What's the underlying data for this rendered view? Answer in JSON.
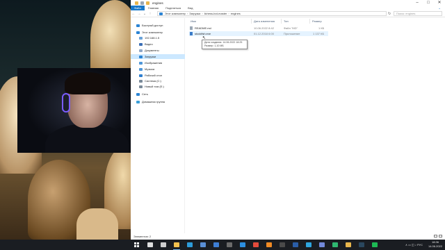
{
  "window": {
    "title": "engines",
    "controls": {
      "minimize": "–",
      "maximize": "□",
      "close": "✕"
    }
  },
  "ribbon": {
    "tabs": [
      "Файл",
      "Главная",
      "Поделиться",
      "Вид"
    ],
    "expand_glyph": "⌄"
  },
  "address": {
    "crumbs": [
      "Этот компьютер",
      "Загрузки",
      "lichess-bot-master",
      "engines"
    ],
    "search_placeholder": "Поиск: engines"
  },
  "navpane": {
    "items": [
      {
        "label": "Быстрый доступ",
        "icon": "star-icon",
        "color": "#2b84d4"
      },
      {
        "label": "Этот компьютер",
        "icon": "computer-icon",
        "color": "#2b84d4"
      },
      {
        "label": "192.168.1.5",
        "icon": "network-drive-icon",
        "color": "#6aa2d8"
      },
      {
        "label": "Видео",
        "icon": "video-folder-icon",
        "color": "#3b6fb6"
      },
      {
        "label": "Документы",
        "icon": "documents-folder-icon",
        "color": "#8fa8c8"
      },
      {
        "label": "Загрузки",
        "icon": "downloads-folder-icon",
        "color": "#2b84d4",
        "selected": true
      },
      {
        "label": "Изображения",
        "icon": "pictures-folder-icon",
        "color": "#4f97d9"
      },
      {
        "label": "Музыка",
        "icon": "music-folder-icon",
        "color": "#4f97d9"
      },
      {
        "label": "Рабочий стол",
        "icon": "desktop-folder-icon",
        "color": "#2f7fd0"
      },
      {
        "label": "Система (C:)",
        "icon": "drive-c-icon",
        "color": "#7a8a99"
      },
      {
        "label": "Новый том (E:)",
        "icon": "drive-e-icon",
        "color": "#7a8a99"
      },
      {
        "label": "Сеть",
        "icon": "network-icon",
        "color": "#2b84d4"
      },
      {
        "label": "Домашняя группа",
        "icon": "homegroup-icon",
        "color": "#3b9fd8"
      }
    ]
  },
  "filelist": {
    "columns": [
      "Имя",
      "Дата изменения",
      "Тип",
      "Размер"
    ],
    "rows": [
      {
        "name": "README.md",
        "date": "10.06.2022 8:42",
        "type": "Файл \"MD\"",
        "size": "1 КБ",
        "icon": "text-file-icon",
        "icon_color": "#9aa7b4"
      },
      {
        "name": "stockfish.exe",
        "date": "01.12.2018 6:00",
        "type": "Приложение",
        "size": "1 137 КБ",
        "icon": "exe-file-icon",
        "icon_color": "#3a7bc8"
      }
    ],
    "tooltip": {
      "line1": "Дата создания: 14.06.2022 18:25",
      "line2": "Размер: 1,10 МБ"
    }
  },
  "status": {
    "items_count": "Элементов: 2"
  },
  "taskbar": {
    "apps": [
      {
        "name": "search-icon",
        "color": "#dddddd"
      },
      {
        "name": "task-view-icon",
        "color": "#cfcfcf"
      },
      {
        "name": "explorer-app-icon",
        "color": "#f2c14e"
      },
      {
        "name": "edge-app-icon",
        "color": "#2d9bd9"
      },
      {
        "name": "store-app-icon",
        "color": "#5a8fd6"
      },
      {
        "name": "mail-app-icon",
        "color": "#3e7fd6"
      },
      {
        "name": "obs-app-icon",
        "color": "#6b6b6b"
      },
      {
        "name": "vscode-app-icon",
        "color": "#2c8fe0"
      },
      {
        "name": "chrome-app-icon",
        "color": "#e34b3c"
      },
      {
        "name": "firefox-app-icon",
        "color": "#f08a24"
      },
      {
        "name": "terminal-app-icon",
        "color": "#4a4a4a"
      },
      {
        "name": "photoshop-app-icon",
        "color": "#2a5ea8"
      },
      {
        "name": "telegram-app-icon",
        "color": "#2ea6e0"
      },
      {
        "name": "discord-app-icon",
        "color": "#7289da"
      },
      {
        "name": "pycharm-app-icon",
        "color": "#2fb871"
      },
      {
        "name": "folder-app-icon",
        "color": "#e8b64c"
      },
      {
        "name": "steam-app-icon",
        "color": "#2a475e"
      },
      {
        "name": "spotify-app-icon",
        "color": "#1db954"
      }
    ],
    "tray_glyphs": "∧  ▭  ◫  ♪  РУС",
    "time": "18:36",
    "date": "14.06.2022"
  }
}
